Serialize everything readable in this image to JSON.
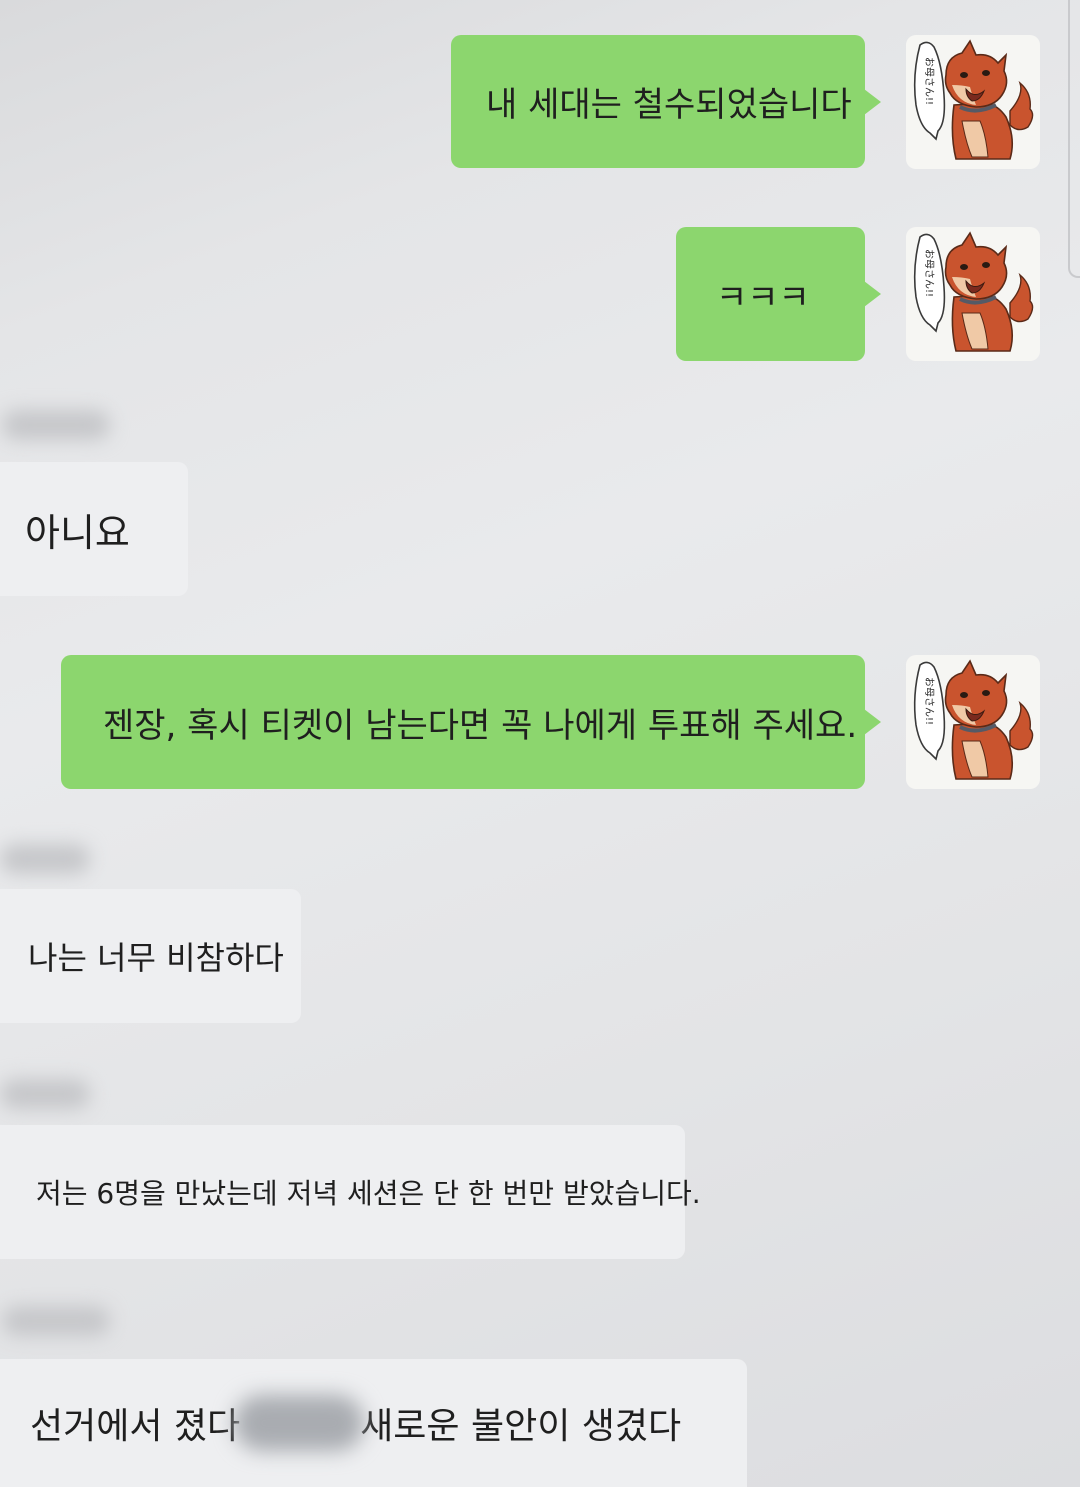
{
  "messages": [
    {
      "direction": "outgoing",
      "text": "내 세대는 철수되었습니다",
      "sticker_icon": "shiba-dog-okaasan-sticker-icon"
    },
    {
      "direction": "outgoing",
      "text": "ㅋㅋㅋ",
      "sticker_icon": "shiba-dog-okaasan-sticker-icon"
    },
    {
      "direction": "incoming",
      "text": "아니요"
    },
    {
      "direction": "outgoing",
      "text": "젠장, 혹시 티켓이 남는다면 꼭 나에게 투표해 주세요.",
      "sticker_icon": "shiba-dog-okaasan-sticker-icon"
    },
    {
      "direction": "incoming",
      "text": "나는 너무 비참하다"
    },
    {
      "direction": "incoming",
      "text": "저는 6명을 만났는데 저녁 세션은 단 한 번만 받았습니다."
    },
    {
      "direction": "incoming",
      "text_before": "선거에서 졌다",
      "text_after": "새로운 불안이 생겼다"
    }
  ],
  "sticker": {
    "caption": "お母さん!!"
  },
  "colors": {
    "outgoing_bubble": "#8cd66e",
    "incoming_bubble": "#eeeff1",
    "background": "#e5e6e8"
  }
}
